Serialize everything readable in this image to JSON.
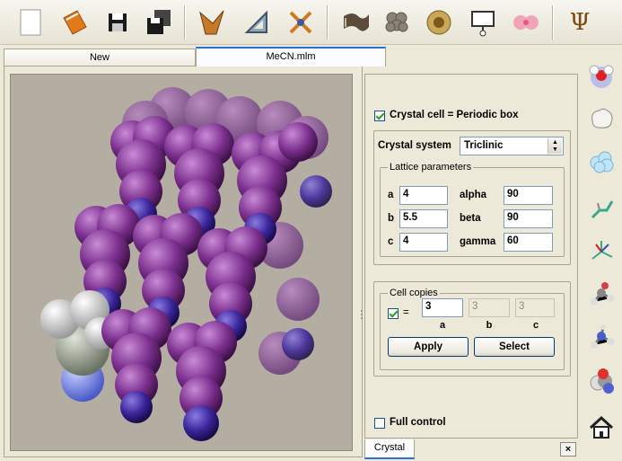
{
  "toolbar": {
    "icons": [
      "new-file-icon",
      "open-book-icon",
      "save-icon",
      "save-all-icon",
      "fragment-icon",
      "measure-icon",
      "scissors-icon",
      "ribbon-icon",
      "molecule-surface-icon",
      "orbital-ring-icon",
      "property-icon",
      "dipole-icon",
      "psi-icon"
    ],
    "psi_label": "Ψ"
  },
  "tabs": [
    {
      "label": "New",
      "active": false
    },
    {
      "label": "MeCN.mlm",
      "active": true
    }
  ],
  "crystal": {
    "periodic_label": "Crystal cell = Periodic box",
    "periodic_checked": true,
    "system_label": "Crystal system",
    "system_value": "Triclinic",
    "lattice_title": "Lattice parameters",
    "a_label": "a",
    "a_value": "4",
    "b_label": "b",
    "b_value": "5.5",
    "c_label": "c",
    "c_value": "4",
    "alpha_label": "alpha",
    "alpha_value": "90",
    "beta_label": "beta",
    "beta_value": "90",
    "gamma_label": "gamma",
    "gamma_value": "60",
    "copies_title": "Cell copies",
    "copies_checked": true,
    "equals": "=",
    "copy_a": "3",
    "copy_b": "3",
    "copy_c": "3",
    "copy_a_label": "a",
    "copy_b_label": "b",
    "copy_c_label": "c",
    "apply_label": "Apply",
    "select_label": "Select",
    "full_control_label": "Full control",
    "full_control_checked": false
  },
  "bottom_tab": {
    "label": "Crystal",
    "close": "×"
  },
  "colors": {
    "molecule": "#8b3a9a",
    "nitrogen": "#3a2a9c",
    "bg": "#b4aea2"
  }
}
